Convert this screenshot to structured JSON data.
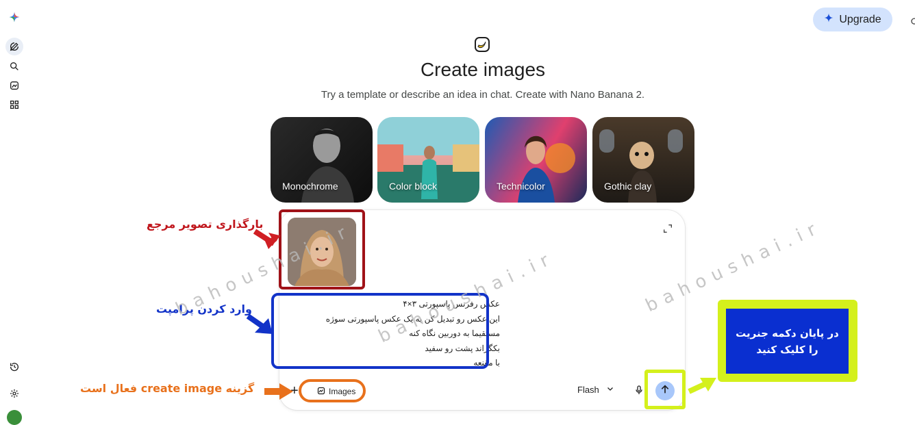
{
  "header": {
    "upgrade_label": "Upgrade"
  },
  "hero": {
    "title": "Create images",
    "subtitle": "Try a template or describe an idea in chat. Create with Nano Banana 2."
  },
  "templates": [
    {
      "label": "Monochrome"
    },
    {
      "label": "Color block"
    },
    {
      "label": "Technicolor"
    },
    {
      "label": "Gothic clay"
    }
  ],
  "prompt_lines": [
    "عکس رفرنس پاسپورتی ۳×۴",
    "این عکس رو تبدیل کن به یک عکس پاسپورتی سوژه",
    "مستقیما به دوربین نگاه کنه",
    "بکگراند پشت رو سفید",
    "با مقنعه"
  ],
  "toolbar": {
    "images_chip_label": "Images",
    "model_label": "Flash"
  },
  "annotations": {
    "upload_reference": "بارگذاری تصویر مرجع",
    "enter_prompt": "وارد کردن پرامپت",
    "create_image_active": "گزینه create image فعال است",
    "generate_line1": "در پایان دکمه جنریت",
    "generate_line2": "را کلیک کنید",
    "watermark": "bahoushai.ir"
  },
  "colors": {
    "annotation_red": "#c0161c",
    "annotation_blue": "#1233c8",
    "annotation_orange": "#e8711c",
    "annotation_lime": "#d4f01c",
    "upgrade_bg": "#d3e3fd",
    "send_bg": "#a8c7fa"
  }
}
